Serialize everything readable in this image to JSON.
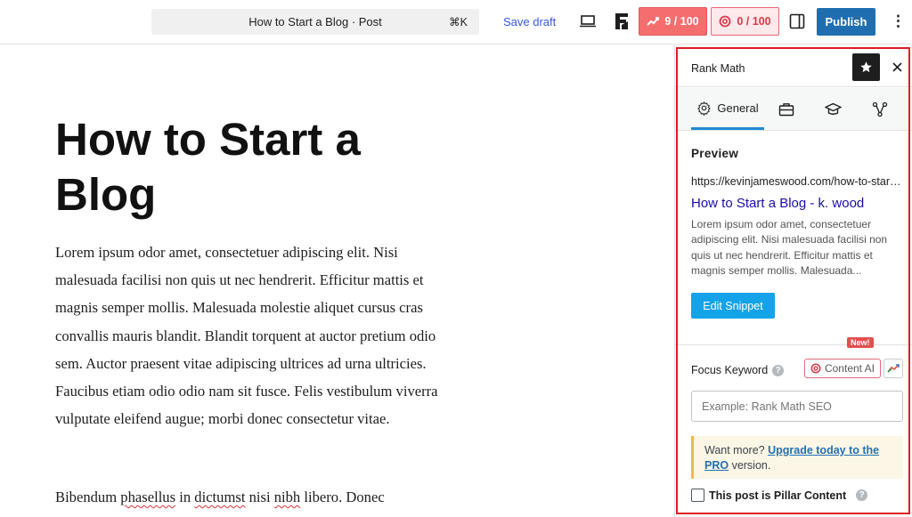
{
  "topbar": {
    "document_title": "How to Start a Blog · Post",
    "shortcut": "⌘K",
    "save_draft": "Save draft",
    "seo_score": "9 / 100",
    "content_ai_score": "0 / 100",
    "publish": "Publish",
    "more": "⋮"
  },
  "editor": {
    "title": "How to Start a Blog",
    "paragraph1": "Lorem ipsum odor amet, consectetuer adipiscing elit. Nisi malesuada facilisi non quis ut nec hendrerit. Efficitur mattis et magnis semper mollis. Malesuada molestie aliquet cursus cras convallis mauris blandit. Blandit torquent at auctor pretium odio sem. Auctor praesent vitae adipiscing ultrices ad urna ultricies. Faucibus etiam odio odio nam sit fusce. Felis vestibulum viverra vulputate eleifend augue; morbi donec consectetur vitae.",
    "paragraph2_start": "Bibendum ",
    "paragraph2_w1": "phasellus",
    "paragraph2_mid1": " in ",
    "paragraph2_w2": "dictumst",
    "paragraph2_mid2": " nisi ",
    "paragraph2_w3": "nibh",
    "paragraph2_end": " libero. Donec"
  },
  "sidebar": {
    "title": "Rank Math",
    "tabs": [
      {
        "label": "General",
        "icon": "gear-icon",
        "active": true
      },
      {
        "label": "",
        "icon": "toolbox-icon"
      },
      {
        "label": "",
        "icon": "graduation-cap-icon"
      },
      {
        "label": "",
        "icon": "schema-icon"
      }
    ],
    "preview": {
      "heading": "Preview",
      "url": "https://kevinjameswood.com/how-to-start-a-blog/",
      "snippet_title": "How to Start a Blog - k. wood",
      "snippet_description": "Lorem ipsum odor amet, consectetuer adipiscing elit. Nisi malesuada facilisi non quis ut nec hendrerit. Efficitur mattis et magnis semper mollis. Malesuada...",
      "edit_button": "Edit Snippet"
    },
    "focus_keyword": {
      "new_badge": "New!",
      "label": "Focus Keyword",
      "content_ai_button": "Content AI",
      "input_placeholder": "Example: Rank Math SEO",
      "input_value": ""
    },
    "upgrade": {
      "prefix": "Want more? ",
      "link": "Upgrade today to the PRO",
      "suffix": " version."
    },
    "pillar_label": "This post is Pillar Content"
  },
  "colors": {
    "accent_blue": "#1f6fb0",
    "seo_score_bg": "#f56e6e",
    "content_ai_bg": "#fde8ea",
    "highlight_outline": "#e01b24",
    "snippet_title": "#1a0dab"
  }
}
